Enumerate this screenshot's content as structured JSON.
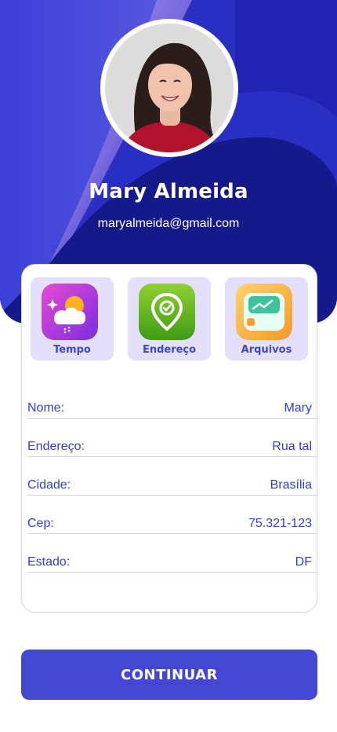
{
  "profile": {
    "name": "Mary Almeida",
    "email": "maryalmeida@gmail.com",
    "avatar_icon": "profile-photo"
  },
  "shortcuts": [
    {
      "label": "Tempo",
      "icon": "weather-icon"
    },
    {
      "label": "Endereço",
      "icon": "location-pin-icon"
    },
    {
      "label": "Arquivos",
      "icon": "files-icon"
    }
  ],
  "fields": [
    {
      "label": "Nome:",
      "value": "Mary"
    },
    {
      "label": "Endereço:",
      "value": "Rua tal"
    },
    {
      "label": "Cidade:",
      "value": "Brasília"
    },
    {
      "label": "Cep:",
      "value": "75.321-123"
    },
    {
      "label": "Estado:",
      "value": "DF"
    }
  ],
  "actions": {
    "continue_label": "CONTINUAR"
  },
  "colors": {
    "primary": "#4447d1",
    "hero_dark": "#141a8a",
    "accent_text": "#2f40c9",
    "tile_bg": "#e4e0fb"
  }
}
